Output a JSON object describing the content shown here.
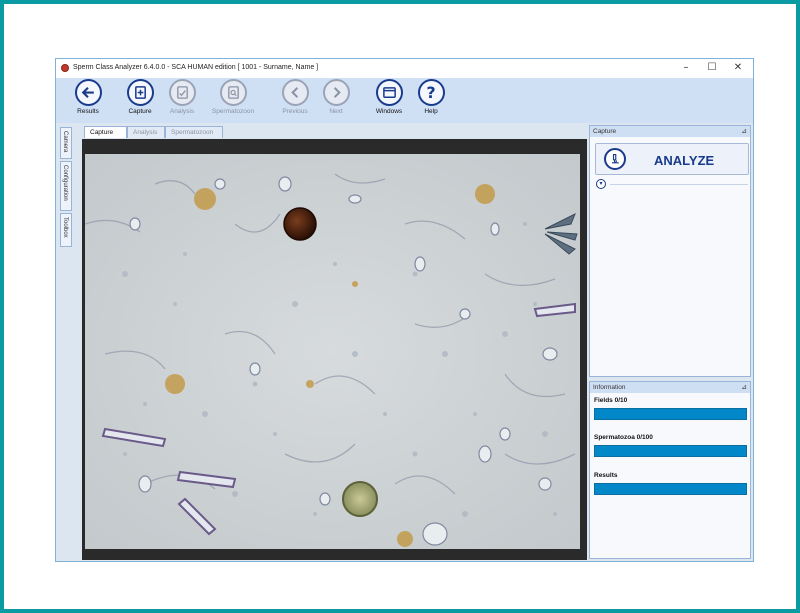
{
  "window": {
    "title": "Sperm Class Analyzer 6.4.0.0 - SCA HUMAN edition [ 1001 - Surname, Name ]",
    "controls": {
      "minimize": "–",
      "maximize": "☐",
      "close": "✕"
    }
  },
  "toolbar": {
    "buttons": [
      {
        "label": "Results",
        "enabled": true
      },
      {
        "label": "Capture",
        "enabled": true
      },
      {
        "label": "Analysis",
        "enabled": false
      },
      {
        "label": "Spermatozoon",
        "enabled": false
      },
      {
        "label": "Previous",
        "enabled": false
      },
      {
        "label": "Next",
        "enabled": false
      },
      {
        "label": "Windows",
        "enabled": true
      },
      {
        "label": "Help",
        "enabled": true
      }
    ]
  },
  "side_tabs": [
    "Camera",
    "Configuration",
    "Toolbox"
  ],
  "view_tabs": {
    "items": [
      "Capture",
      "Analysis",
      "Spermatozoon"
    ],
    "active": "Capture"
  },
  "capture_panel": {
    "title": "Capture",
    "analyze_label": "ANALYZE"
  },
  "information_panel": {
    "title": "Information",
    "fields_label": "Fields 0/10",
    "spermatozoa_label": "Spermatozoa 0/100",
    "results_label": "Results"
  },
  "colors": {
    "accent": "#1a3a8c",
    "progress": "#0288c8",
    "background": "#0a9ba3"
  }
}
